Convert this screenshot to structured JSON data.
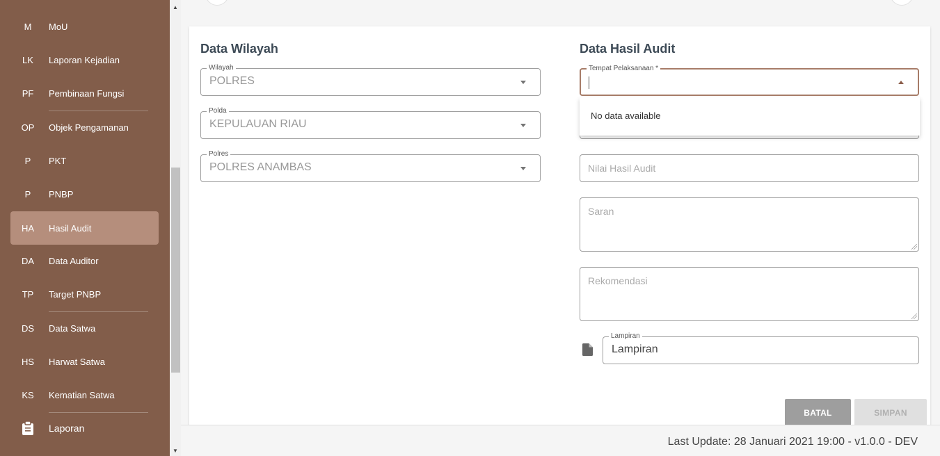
{
  "sidebar": {
    "items": [
      {
        "abbr": "M",
        "label": "MoU"
      },
      {
        "abbr": "LK",
        "label": "Laporan Kejadian"
      },
      {
        "abbr": "PF",
        "label": "Pembinaan Fungsi"
      },
      {
        "abbr": "OP",
        "label": "Objek Pengamanan"
      },
      {
        "abbr": "P",
        "label": "PKT"
      },
      {
        "abbr": "P",
        "label": "PNBP"
      },
      {
        "abbr": "HA",
        "label": "Hasil Audit"
      },
      {
        "abbr": "DA",
        "label": "Data Auditor"
      },
      {
        "abbr": "TP",
        "label": "Target PNBP"
      },
      {
        "abbr": "DS",
        "label": "Data Satwa"
      },
      {
        "abbr": "HS",
        "label": "Harwat Satwa"
      },
      {
        "abbr": "KS",
        "label": "Kematian Satwa"
      }
    ],
    "laporan_label": "Laporan",
    "laporan_icon": "clipboard-icon",
    "active_item": "Hasil Audit"
  },
  "left_section": {
    "title": "Data Wilayah",
    "wilayah": {
      "legend": "Wilayah",
      "value": "POLRES"
    },
    "polda": {
      "legend": "Polda",
      "value": "KEPULAUAN RIAU"
    },
    "polres": {
      "legend": "Polres",
      "value": "POLRES ANAMBAS"
    }
  },
  "right_section": {
    "title": "Data Hasil Audit",
    "tempat": {
      "legend": "Tempat Pelaksanaan *",
      "value": ""
    },
    "dropdown_message": "No data available",
    "nilai_placeholder": "Nilai Hasil Audit",
    "saran_placeholder": "Saran",
    "rekomendasi_placeholder": "Rekomendasi",
    "lampiran": {
      "legend": "Lampiran",
      "value": "Lampiran",
      "icon": "file-icon"
    }
  },
  "buttons": {
    "batal": "BATAL",
    "simpan": "SIMPAN"
  },
  "footer": {
    "text": "Last Update: 28 Januari 2021 19:00 - v1.0.0 - DEV"
  },
  "colors": {
    "sidebar_bg": "#825d4a",
    "sidebar_active": "#b58e7c",
    "focus_border": "#a77c68",
    "batal_bg": "#9e9e9e",
    "simpan_bg": "#e0e0e0"
  }
}
